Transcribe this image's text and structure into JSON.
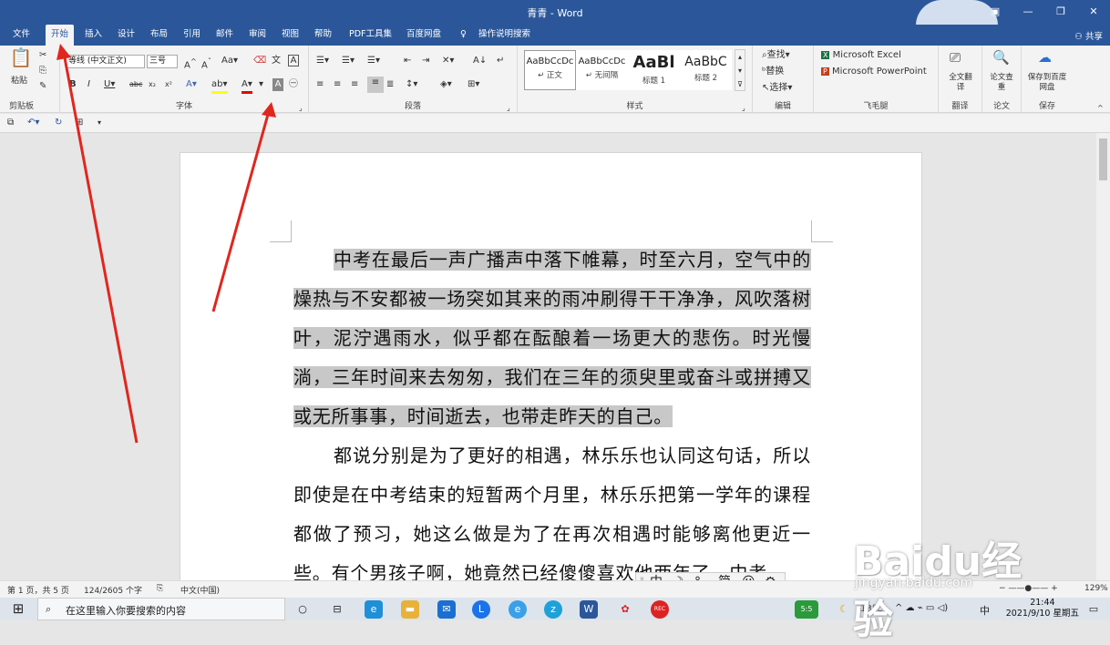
{
  "titlebar": {
    "title": "青青 - Word"
  },
  "tabs": [
    "文件",
    "开始",
    "插入",
    "设计",
    "布局",
    "引用",
    "邮件",
    "审阅",
    "视图",
    "帮助",
    "PDF工具集",
    "百度网盘",
    "操作说明搜索"
  ],
  "share_label": "共享",
  "ribbon": {
    "clipboard": {
      "paste": "粘贴",
      "label": "剪贴板"
    },
    "font": {
      "name": "等线 (中文正文)",
      "size": "三号",
      "label": "字体"
    },
    "paragraph": {
      "label": "段落"
    },
    "styles": {
      "label": "样式",
      "items": [
        {
          "preview": "AaBbCcDc",
          "name": "↵ 正文"
        },
        {
          "preview": "AaBbCcDc",
          "name": "↵ 无间隔"
        },
        {
          "preview": "AaBl",
          "name": "标题 1"
        },
        {
          "preview": "AaBbC",
          "name": "标题 2"
        }
      ]
    },
    "editing": {
      "find": "查找",
      "replace": "替换",
      "select": "选择",
      "label": "编辑"
    },
    "feimao": {
      "excel": "Microsoft Excel",
      "ppt": "Microsoft PowerPoint",
      "label": "飞毛腿"
    },
    "translate": {
      "btn": "全文翻译",
      "label": "翻译"
    },
    "paper": {
      "btn": "论文查重",
      "label": "论文"
    },
    "save": {
      "btn": "保存到百度网盘",
      "label": "保存"
    }
  },
  "document": {
    "para1": "中考在最后一声广播声中落下帷幕，时至六月，空气中的燥热与不安都被一场突如其来的雨冲刷得干干净净，风吹落树叶，泥泞遇雨水，似乎都在酝酿着一场更大的悲伤。时光慢淌，三年时间来去匆匆，我们在三年的须臾里或奋斗或拼搏又或无所事事，时间逝去，也带走昨天的自己。",
    "para2": "都说分别是为了更好的相遇，林乐乐也认同这句话，所以即使是在中考结束的短暂两个月里，林乐乐把第一学年的课程都做了预习，她这么做是为了在再次相遇时能够离他更近一些。有个男孩子啊，她竟然已经傻傻喜欢他两年了。中考"
  },
  "status": {
    "page": "第 1 页，共 5 页",
    "words": "124/2605 个字",
    "lang": "中文(中国)",
    "zoom": "129%"
  },
  "ime": {
    "mode": "中",
    "simp": "简"
  },
  "taskbar": {
    "search_placeholder": "在这里输入你要搜索的内容",
    "temp": "13°C",
    "ime": "中",
    "time": "21:44",
    "date": "2021/9/10 星期五"
  },
  "watermark": {
    "brand": "Baidu经验",
    "url": "jingyan.baidu.com"
  }
}
